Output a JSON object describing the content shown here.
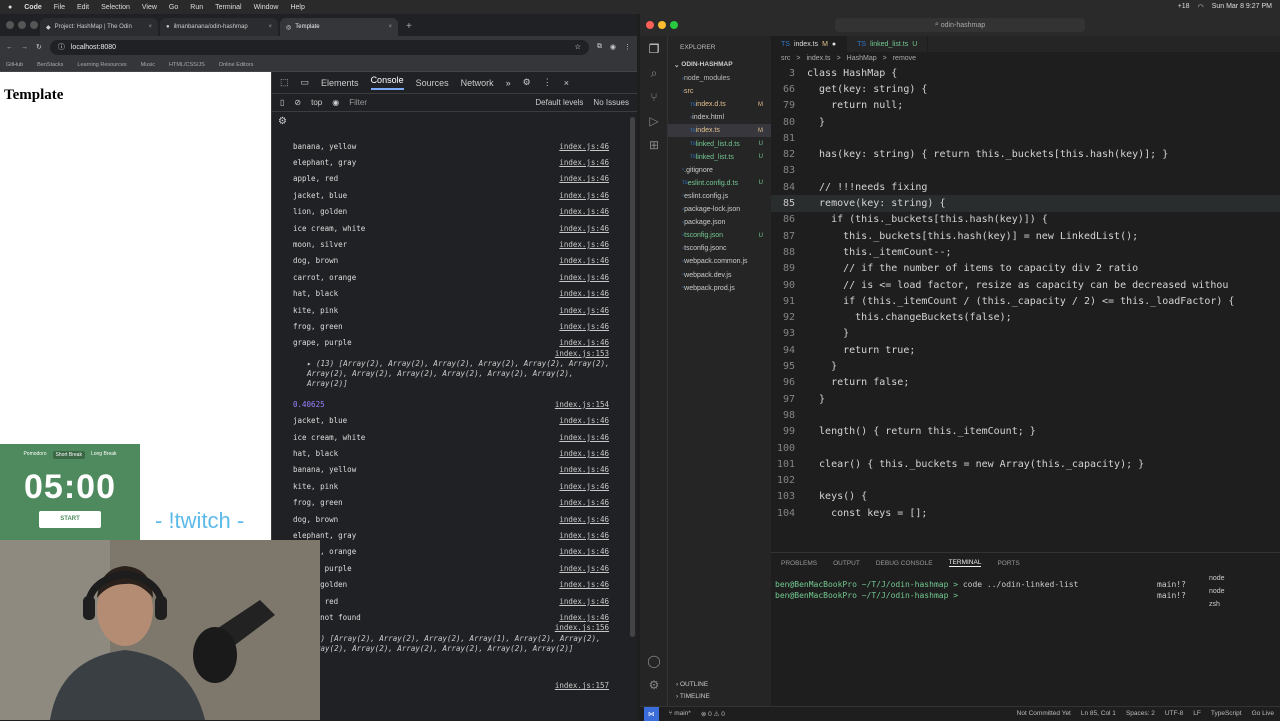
{
  "menubar": {
    "app": "Code",
    "menus": [
      "File",
      "Edit",
      "Selection",
      "View",
      "Go",
      "Run",
      "Terminal",
      "Window",
      "Help"
    ],
    "datetime": "Sun Mar 8  9:27 PM",
    "battery": "+18"
  },
  "chrome": {
    "tabs": [
      {
        "title": "Project: HashMap | The Odin",
        "active": false
      },
      {
        "title": "ilmanbanana/odin-hashmap",
        "active": false
      },
      {
        "title": "Template",
        "active": true
      }
    ],
    "url": "localhost:8080",
    "bookmarks": [
      "GitHub",
      "BenStacks",
      "Learning Resources",
      "Music",
      "HTML/CSS/JS",
      "Online Editors"
    ],
    "page_heading": "Template"
  },
  "devtools": {
    "tabs": [
      "Elements",
      "Console",
      "Sources",
      "Network"
    ],
    "active_tab": "Console",
    "context": "top",
    "filter_placeholder": "Filter",
    "levels": "Default levels",
    "issues": "No Issues",
    "logs1": [
      {
        "msg": "banana, yellow",
        "src": "index.js:46"
      },
      {
        "msg": "elephant, gray",
        "src": "index.js:46"
      },
      {
        "msg": "apple, red",
        "src": "index.js:46"
      },
      {
        "msg": "jacket, blue",
        "src": "index.js:46"
      },
      {
        "msg": "lion, golden",
        "src": "index.js:46"
      },
      {
        "msg": "ice cream, white",
        "src": "index.js:46"
      },
      {
        "msg": "moon, silver",
        "src": "index.js:46"
      },
      {
        "msg": "dog, brown",
        "src": "index.js:46"
      },
      {
        "msg": "carrot, orange",
        "src": "index.js:46"
      },
      {
        "msg": "hat, black",
        "src": "index.js:46"
      },
      {
        "msg": "kite, pink",
        "src": "index.js:46"
      },
      {
        "msg": "frog, green",
        "src": "index.js:46"
      },
      {
        "msg": "grape, purple",
        "src": "index.js:46"
      }
    ],
    "array1_src": "index.js:153",
    "array1": "▸ (13) [Array(2), Array(2), Array(2), Array(2), Array(2), Array(2), Array(2), Array(2), Array(2), Array(2), Array(2), Array(2), Array(2)]",
    "number": "0.40625",
    "number_src": "index.js:154",
    "logs2": [
      {
        "msg": "jacket, blue",
        "src": "index.js:46"
      },
      {
        "msg": "ice cream, white",
        "src": "index.js:46"
      },
      {
        "msg": "hat, black",
        "src": "index.js:46"
      },
      {
        "msg": "banana, yellow",
        "src": "index.js:46"
      },
      {
        "msg": "kite, pink",
        "src": "index.js:46"
      },
      {
        "msg": "frog, green",
        "src": "index.js:46"
      },
      {
        "msg": "dog, brown",
        "src": "index.js:46"
      },
      {
        "msg": "elephant, gray",
        "src": "index.js:46"
      },
      {
        "msg": "carrot, orange",
        "src": "index.js:46"
      },
      {
        "msg": "grape, purple",
        "src": "index.js:46"
      },
      {
        "msg": "lion, golden",
        "src": "index.js:46"
      },
      {
        "msg": "apple, red",
        "src": "index.js:46"
      },
      {
        "msg": "moon, not found",
        "src": "index.js:46"
      }
    ],
    "array2_src": "index.js:156",
    "array2": "(12) [Array(2), Array(2), Array(2), Array(1), Array(2), Array(2), Array(2), Array(2), Array(2), Array(2), Array(2), Array(2)]",
    "last_src": "index.js:157"
  },
  "pomodoro": {
    "modes": [
      "Pomodoro",
      "Short Break",
      "Long Break"
    ],
    "active_mode": "Short Break",
    "time": "05:00",
    "start_label": "START"
  },
  "overlay_text": "- !twitch -",
  "vscode": {
    "title": "odin-hashmap",
    "explorer_label": "EXPLORER",
    "project": "ODIN-HASHMAP",
    "files": [
      {
        "name": "node_modules",
        "status": "",
        "color": "#bbbbbb",
        "indent": 1
      },
      {
        "name": "src",
        "status": "",
        "color": "#e2c08d",
        "indent": 1
      },
      {
        "name": "index.d.ts",
        "status": "M",
        "color": "#e2c08d",
        "indent": 2
      },
      {
        "name": "index.html",
        "status": "",
        "color": "#cccccc",
        "indent": 2
      },
      {
        "name": "index.ts",
        "status": "M",
        "color": "#e2c08d",
        "indent": 2
      },
      {
        "name": "linked_list.d.ts",
        "status": "U",
        "color": "#73c991",
        "indent": 2
      },
      {
        "name": "linked_list.ts",
        "status": "U",
        "color": "#73c991",
        "indent": 2
      },
      {
        "name": ".gitignore",
        "status": "",
        "color": "#cccccc",
        "indent": 1
      },
      {
        "name": "eslint.config.d.ts",
        "status": "U",
        "color": "#73c991",
        "indent": 1
      },
      {
        "name": "eslint.config.js",
        "status": "",
        "color": "#cccccc",
        "indent": 1
      },
      {
        "name": "package-lock.json",
        "status": "",
        "color": "#cccccc",
        "indent": 1
      },
      {
        "name": "package.json",
        "status": "",
        "color": "#cccccc",
        "indent": 1
      },
      {
        "name": "tsconfig.json",
        "status": "U",
        "color": "#73c991",
        "indent": 1
      },
      {
        "name": "tsconfig.jsonc",
        "status": "",
        "color": "#cccccc",
        "indent": 1
      },
      {
        "name": "webpack.common.js",
        "status": "",
        "color": "#cccccc",
        "indent": 1
      },
      {
        "name": "webpack.dev.js",
        "status": "",
        "color": "#cccccc",
        "indent": 1
      },
      {
        "name": "webpack.prod.js",
        "status": "",
        "color": "#cccccc",
        "indent": 1
      }
    ],
    "outline": "OUTLINE",
    "timeline": "TIMELINE",
    "editor_tabs": [
      {
        "label": "index.ts",
        "mod": "M",
        "active": true
      },
      {
        "label": "linked_list.ts",
        "mod": "U",
        "active": false
      }
    ],
    "breadcrumbs": [
      "src",
      ">",
      "index.ts",
      ">",
      "HashMap",
      ">",
      "remove"
    ],
    "code": [
      {
        "n": "3",
        "t": "class HashMap {"
      },
      {
        "n": "66",
        "t": "  get(key: string) {"
      },
      {
        "n": "79",
        "t": "    return null;"
      },
      {
        "n": "80",
        "t": "  }"
      },
      {
        "n": "81",
        "t": ""
      },
      {
        "n": "82",
        "t": "  has(key: string) { return this._buckets[this.hash(key)]; }"
      },
      {
        "n": "83",
        "t": ""
      },
      {
        "n": "84",
        "t": "  // !!!needs fixing"
      },
      {
        "n": "85",
        "t": "  remove(key: string) {"
      },
      {
        "n": "86",
        "t": "    if (this._buckets[this.hash(key)]) {"
      },
      {
        "n": "87",
        "t": "      this._buckets[this.hash(key)] = new LinkedList();"
      },
      {
        "n": "88",
        "t": "      this._itemCount--;"
      },
      {
        "n": "89",
        "t": "      // if the number of items to capacity div 2 ratio"
      },
      {
        "n": "90",
        "t": "      // is <= load factor, resize as capacity can be decreased withou"
      },
      {
        "n": "91",
        "t": "      if (this._itemCount / (this._capacity / 2) <= this._loadFactor) {"
      },
      {
        "n": "92",
        "t": "        this.changeBuckets(false);"
      },
      {
        "n": "93",
        "t": "      }"
      },
      {
        "n": "94",
        "t": "      return true;"
      },
      {
        "n": "95",
        "t": "    }"
      },
      {
        "n": "96",
        "t": "    return false;"
      },
      {
        "n": "97",
        "t": "  }"
      },
      {
        "n": "98",
        "t": ""
      },
      {
        "n": "99",
        "t": "  length() { return this._itemCount; }"
      },
      {
        "n": "100",
        "t": ""
      },
      {
        "n": "101",
        "t": "  clear() { this._buckets = new Array(this._capacity); }"
      },
      {
        "n": "102",
        "t": ""
      },
      {
        "n": "103",
        "t": "  keys() {"
      },
      {
        "n": "104",
        "t": "    const keys = [];"
      }
    ],
    "panel_tabs": [
      "PROBLEMS",
      "OUTPUT",
      "DEBUG CONSOLE",
      "TERMINAL",
      "PORTS"
    ],
    "active_panel": "TERMINAL",
    "terminal": [
      {
        "prompt": "ben@BenMacBookPro ~/T/J/odin-hashmap > ",
        "cmd": "code ../odin-linked-list",
        "branch": "main!?"
      },
      {
        "prompt": "ben@BenMacBookPro ~/T/J/odin-hashmap > ",
        "cmd": "",
        "branch": "main!?"
      }
    ],
    "terminals": [
      "node",
      "node",
      "zsh"
    ],
    "status": {
      "branch": "main*",
      "problems": "0",
      "warnings": "0",
      "right": [
        "Not Committed Yet",
        "Ln 85, Col 1",
        "Spaces: 2",
        "UTF-8",
        "LF",
        "TypeScript",
        "Go Live"
      ]
    }
  }
}
